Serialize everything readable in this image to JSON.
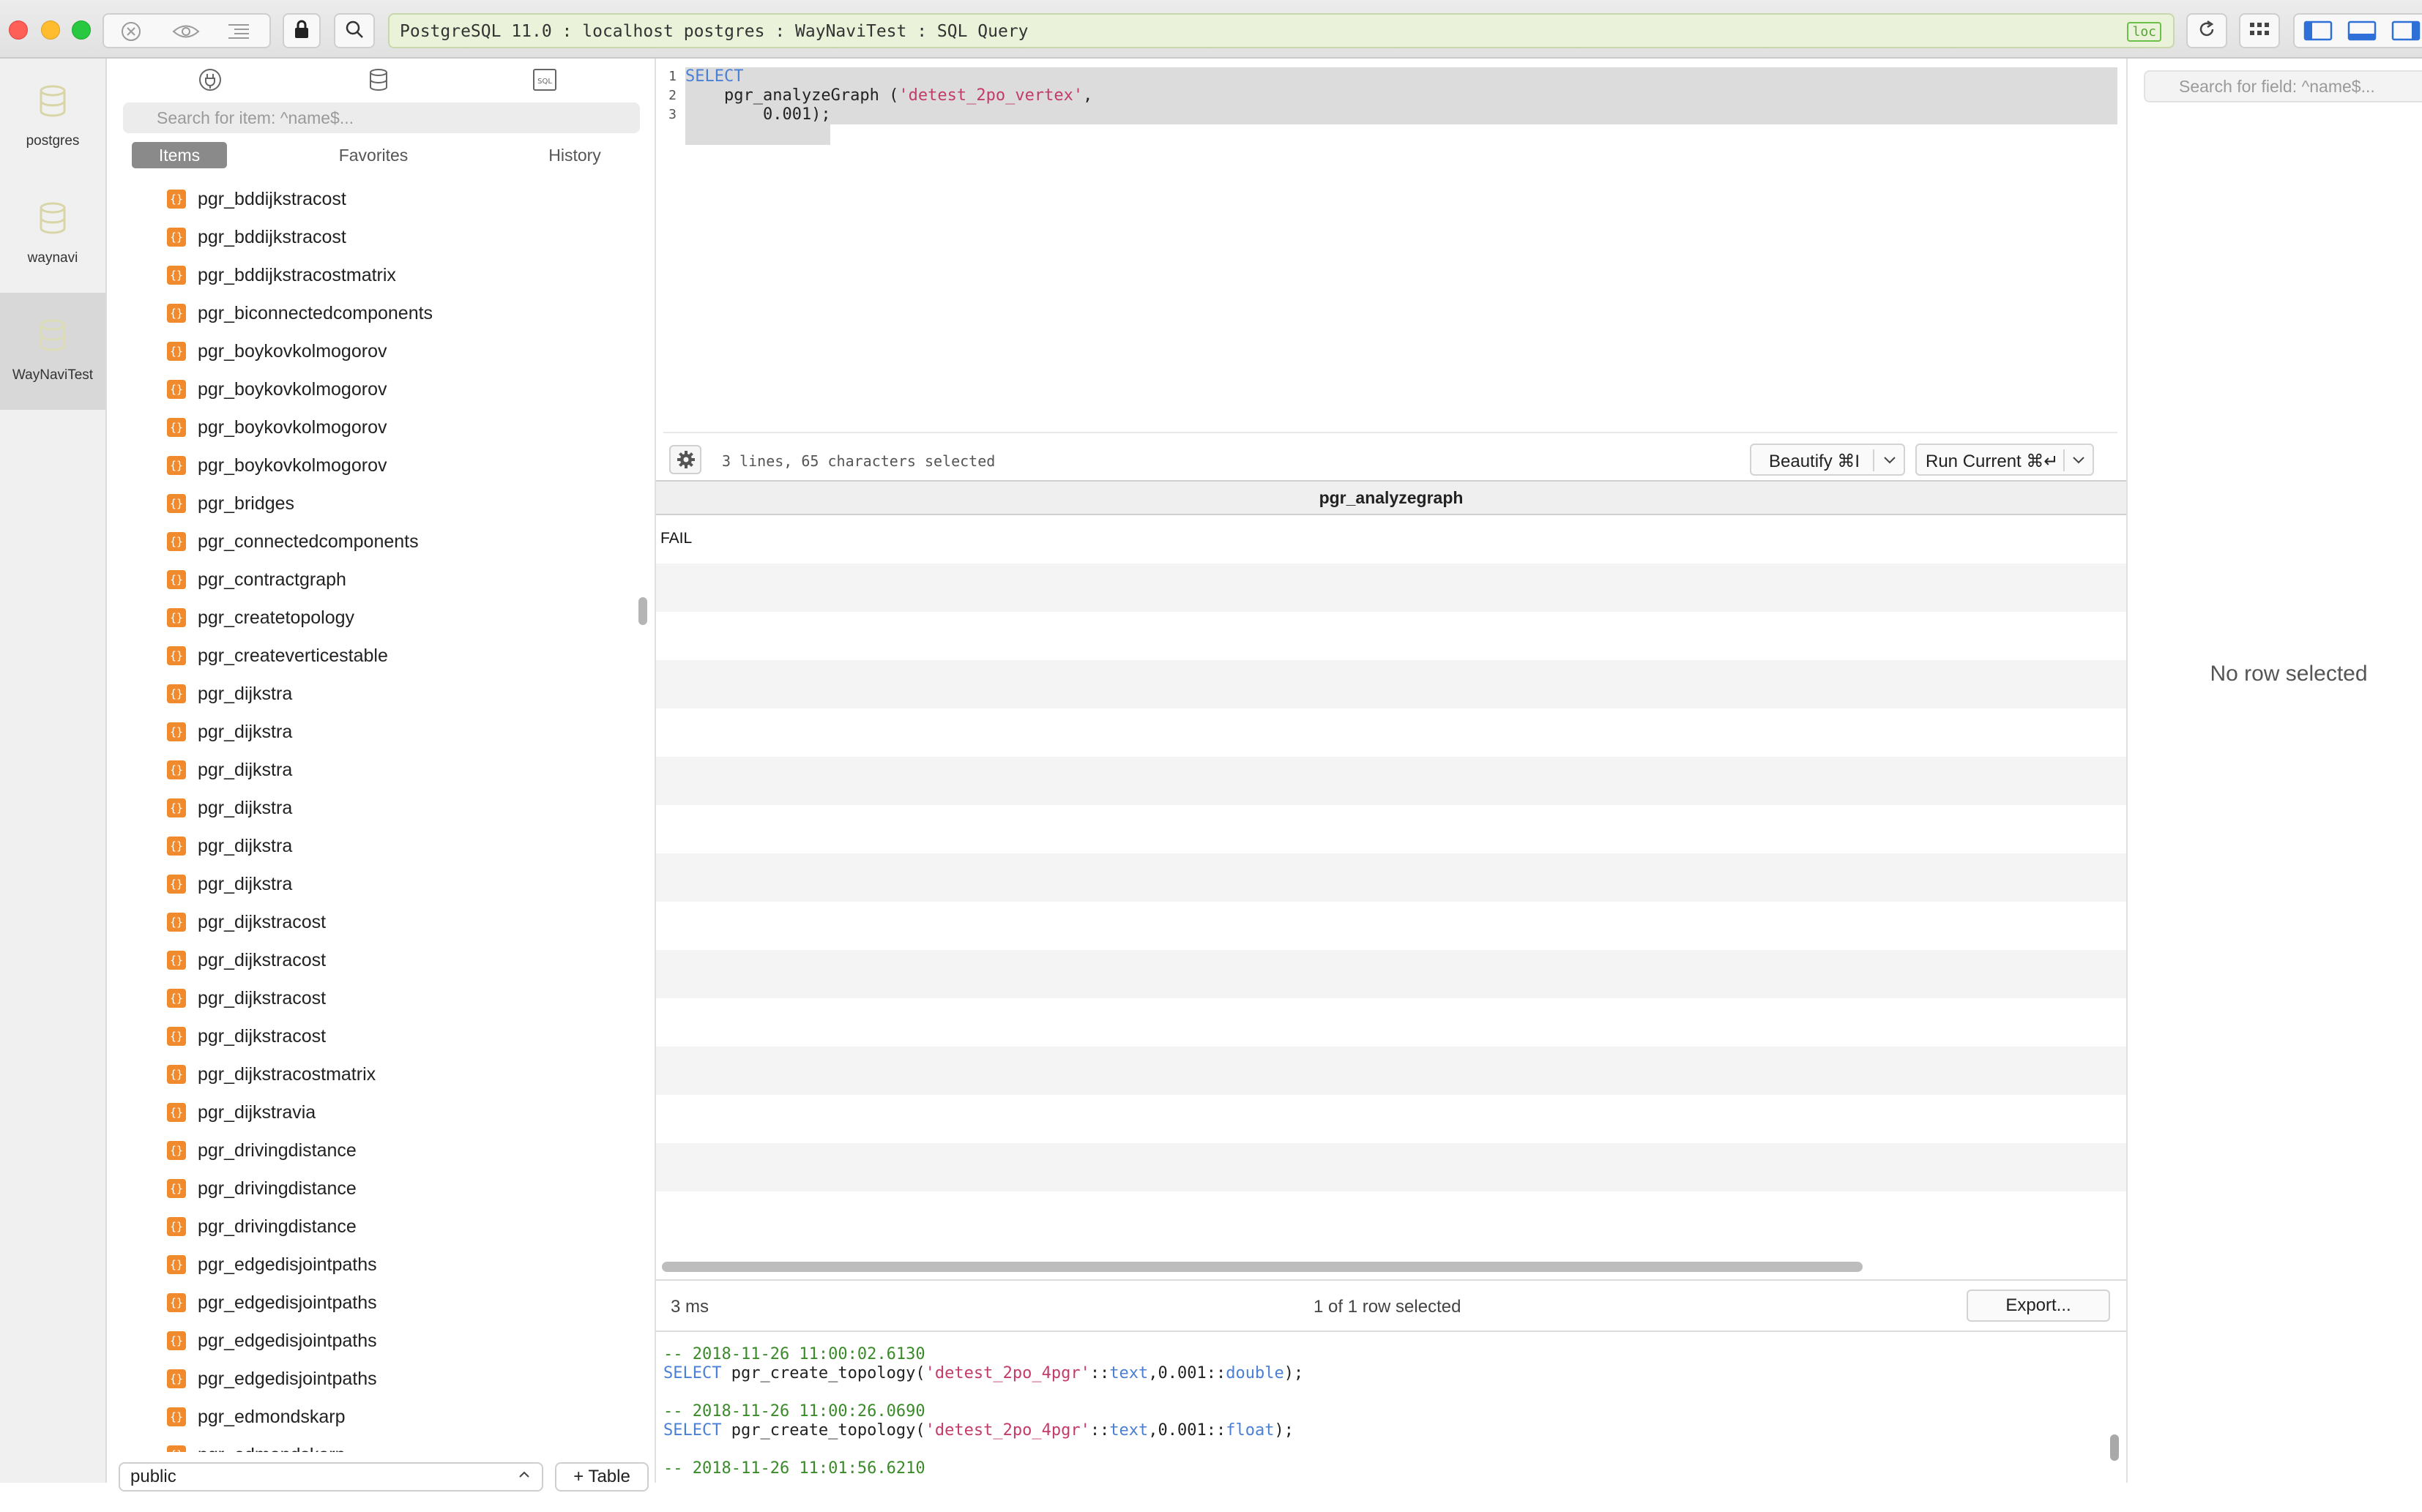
{
  "titlebar": {
    "address": "PostgreSQL 11.0 : localhost postgres : WayNaviTest : SQL Query",
    "badge": "loc"
  },
  "connections": [
    {
      "label": "postgres"
    },
    {
      "label": "waynavi"
    },
    {
      "label": "WayNaviTest"
    }
  ],
  "sidebar": {
    "search_placeholder": "Search for item: ^name$...",
    "segments": {
      "items": "Items",
      "favorites": "Favorites",
      "history": "History"
    },
    "items": [
      "pgr_bddijkstracost",
      "pgr_bddijkstracost",
      "pgr_bddijkstracostmatrix",
      "pgr_biconnectedcomponents",
      "pgr_boykovkolmogorov",
      "pgr_boykovkolmogorov",
      "pgr_boykovkolmogorov",
      "pgr_boykovkolmogorov",
      "pgr_bridges",
      "pgr_connectedcomponents",
      "pgr_contractgraph",
      "pgr_createtopology",
      "pgr_createverticestable",
      "pgr_dijkstra",
      "pgr_dijkstra",
      "pgr_dijkstra",
      "pgr_dijkstra",
      "pgr_dijkstra",
      "pgr_dijkstra",
      "pgr_dijkstracost",
      "pgr_dijkstracost",
      "pgr_dijkstracost",
      "pgr_dijkstracost",
      "pgr_dijkstracostmatrix",
      "pgr_dijkstravia",
      "pgr_drivingdistance",
      "pgr_drivingdistance",
      "pgr_drivingdistance",
      "pgr_edgedisjointpaths",
      "pgr_edgedisjointpaths",
      "pgr_edgedisjointpaths",
      "pgr_edgedisjointpaths",
      "pgr_edmondskarp",
      "pgr_edmondskarp"
    ],
    "schema": "public",
    "add_table": "+ Table"
  },
  "editor": {
    "line_numbers": [
      "1",
      "2",
      "3"
    ],
    "line1_kw": "SELECT",
    "line2_fn": "    pgr_analyzeGraph (",
    "line2_str": "'detest_2po_vertex'",
    "line2_end": ",",
    "line3": "        0.001);",
    "status": "3 lines, 65 characters selected",
    "beautify_label": "Beautify ⌘I",
    "run_label": "Run Current ⌘↵"
  },
  "results": {
    "columns": [
      "pgr_analyzegraph"
    ],
    "rows": [
      [
        "FAIL"
      ]
    ],
    "time": "3 ms",
    "selection": "1 of 1 row selected",
    "export_label": "Export..."
  },
  "history": {
    "entries": [
      {
        "comment": "-- 2018-11-26 11:00:02.6130",
        "kw": "SELECT",
        "fn": " pgr_create_topology(",
        "str": "'detest_2po_4pgr'",
        "cast1": "::",
        "type1": "text",
        "mid": ",0.001::",
        "type2": "double",
        "end": ");"
      },
      {
        "comment": "-- 2018-11-26 11:00:26.0690",
        "kw": "SELECT",
        "fn": " pgr_create_topology(",
        "str": "'detest_2po_4pgr'",
        "cast1": "::",
        "type1": "text",
        "mid": ",0.001::",
        "type2": "float",
        "end": ");"
      },
      {
        "comment": "-- 2018-11-26 11:01:56.6210"
      }
    ]
  },
  "inspector": {
    "search_placeholder": "Search for field: ^name$...",
    "empty": "No row selected"
  },
  "colors": {
    "accent_blue": "#4a7fd6",
    "function_icon": "#f08a2c",
    "address_bg": "#eaf3d9",
    "string": "#c33b6a",
    "comment": "#3a8a2a"
  }
}
